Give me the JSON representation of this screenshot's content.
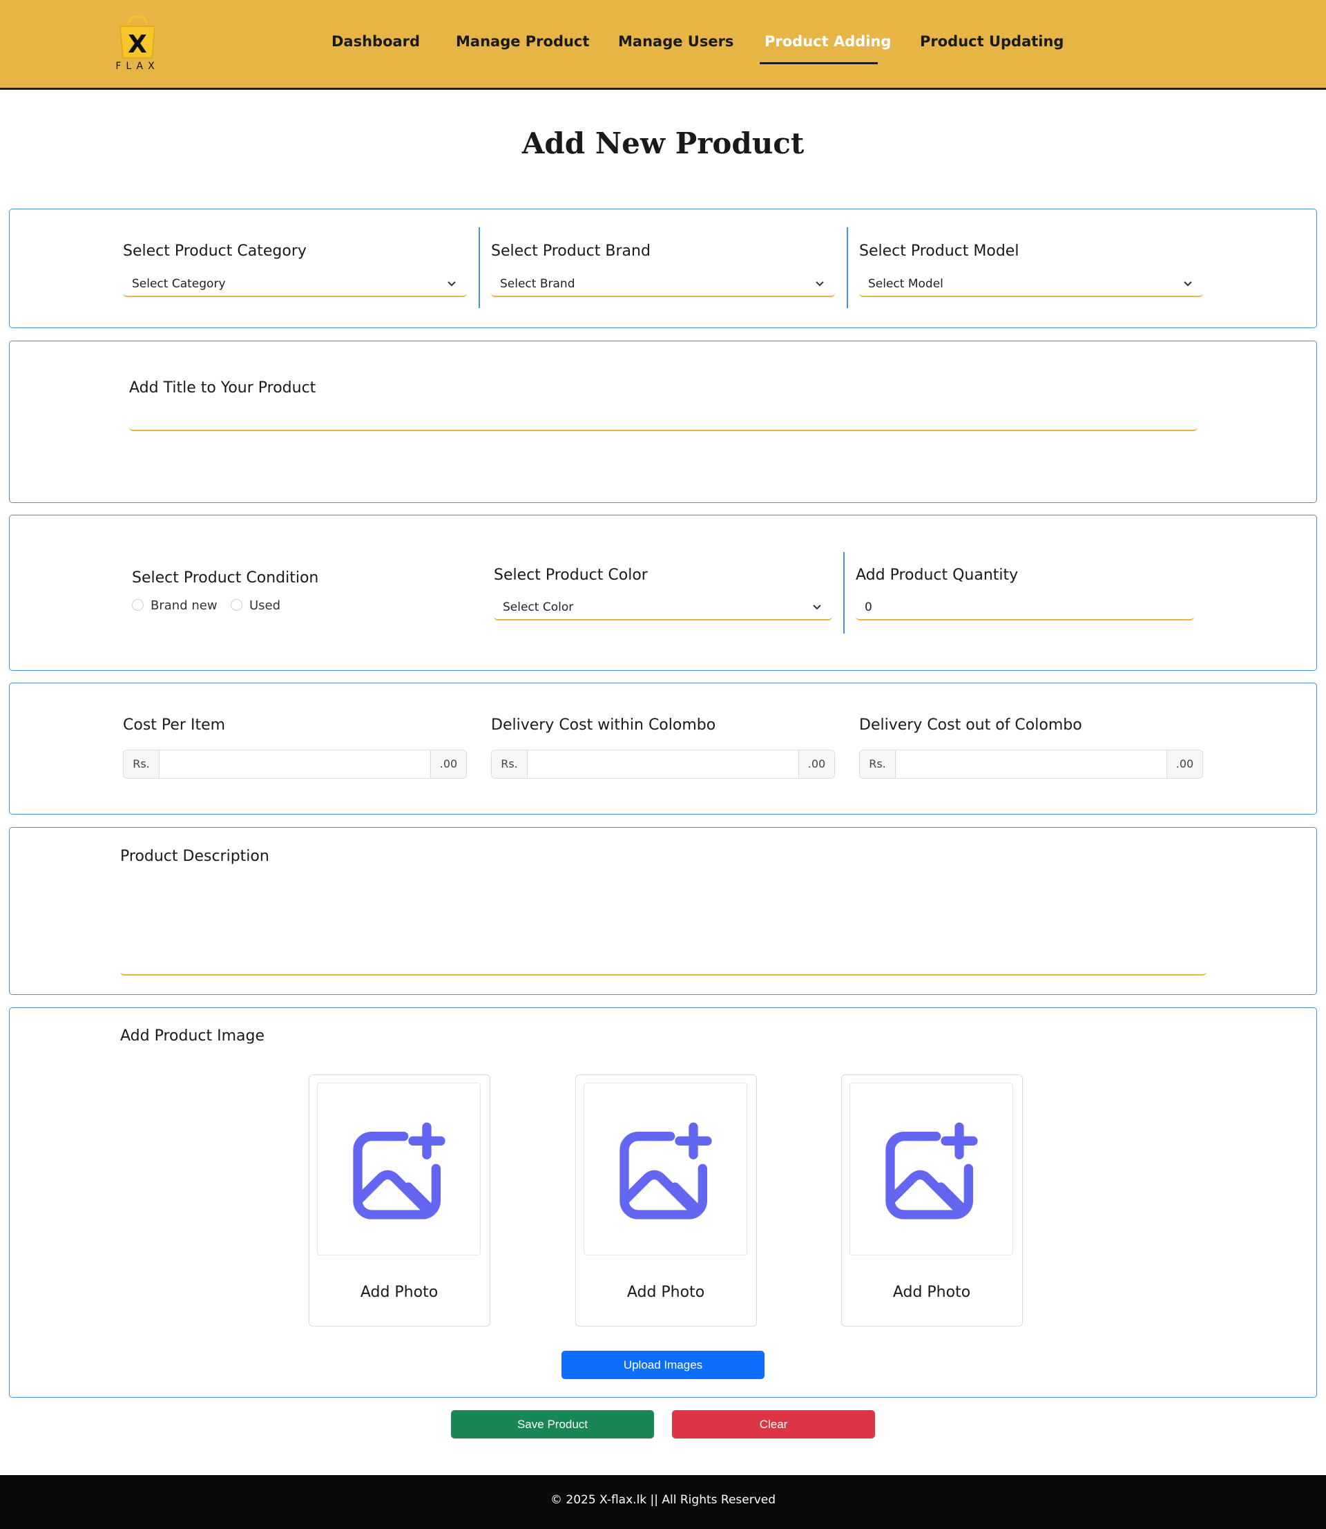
{
  "header": {
    "logo_text": "FLAX",
    "logo_mark": "X",
    "nav": [
      {
        "label": "Dashboard"
      },
      {
        "label": "Manage Product"
      },
      {
        "label": "Manage Users"
      },
      {
        "label": "Product Adding",
        "active": true
      },
      {
        "label": "Product Updating"
      }
    ]
  },
  "page": {
    "title": "Add New Product"
  },
  "selects_row": {
    "category": {
      "label": "Select Product Category",
      "value": "Select Category"
    },
    "brand": {
      "label": "Select Product Brand",
      "value": "Select Brand"
    },
    "model": {
      "label": "Select Product Model",
      "value": "Select Model"
    }
  },
  "title_section": {
    "label": "Add Title to Your Product",
    "value": ""
  },
  "condition_section": {
    "condition_label": "Select Product Condition",
    "condition_options": [
      "Brand new",
      "Used"
    ],
    "color_label": "Select Product Color",
    "color_value": "Select Color",
    "quantity_label": "Add Product Quantity",
    "quantity_value": "0"
  },
  "cost_section": {
    "currency_prefix": "Rs.",
    "suffix": ".00",
    "cost_per_item_label": "Cost Per Item",
    "delivery_in_label": "Delivery Cost within Colombo",
    "delivery_out_label": "Delivery Cost out of Colombo"
  },
  "description_section": {
    "label": "Product Description",
    "value": ""
  },
  "image_section": {
    "label": "Add Product Image",
    "photo_label": "Add Photo",
    "upload_button": "Upload Images"
  },
  "actions": {
    "save": "Save Product",
    "clear": "Clear"
  },
  "footer": {
    "text": "© 2025 X-flax.lk || All Rights Reserved"
  },
  "colors": {
    "header_bg": "#e6b545",
    "accent_border": "#4a8fe0",
    "input_underline": "#e6b545",
    "icon_purple": "#6366f1",
    "upload_blue": "#0d6efd",
    "save_green": "#198754",
    "clear_red": "#dc3545"
  }
}
